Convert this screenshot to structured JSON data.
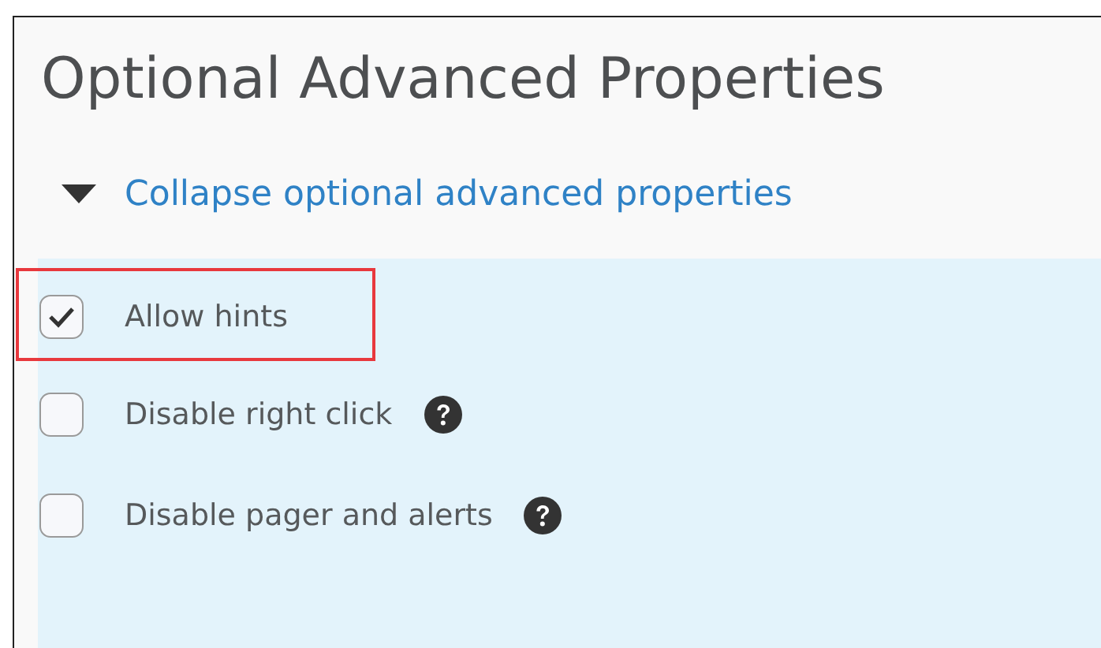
{
  "heading": "Optional Advanced Properties",
  "toggle": {
    "label": "Collapse optional advanced properties",
    "expanded": true
  },
  "options": [
    {
      "label": "Allow hints",
      "checked": true,
      "has_help": false,
      "highlighted": true
    },
    {
      "label": "Disable right click",
      "checked": false,
      "has_help": true,
      "highlighted": false
    },
    {
      "label": "Disable pager and alerts",
      "checked": false,
      "has_help": true,
      "highlighted": false
    }
  ]
}
